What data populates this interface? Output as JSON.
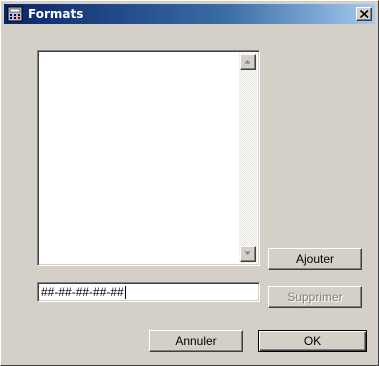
{
  "window": {
    "title": "Formats",
    "app_icon": "calculator-icon",
    "close_icon": "close-icon"
  },
  "list": {
    "items": [],
    "scroll_up_icon": "arrow-up-icon",
    "scroll_down_icon": "arrow-down-icon"
  },
  "format_input": {
    "value": "##-##-##-##-##"
  },
  "buttons": {
    "add_label": "Ajouter",
    "delete_label": "Supprimer",
    "cancel_label": "Annuler",
    "ok_label": "OK"
  },
  "colors": {
    "title_active": "#0a246a",
    "face": "#d4d0c8",
    "disabled_text": "#808080"
  }
}
